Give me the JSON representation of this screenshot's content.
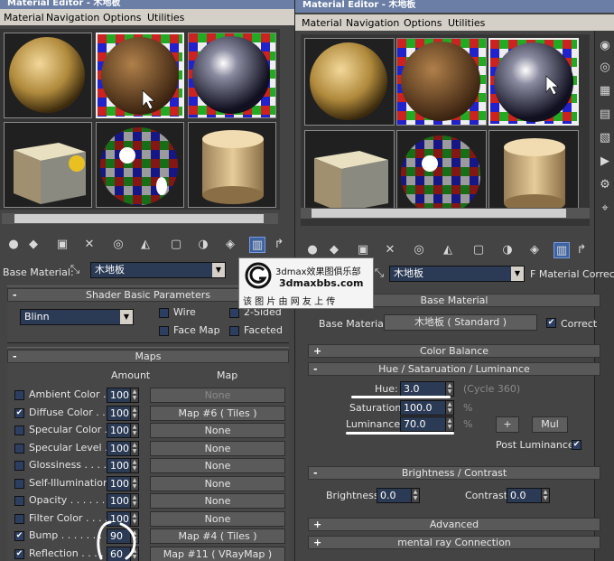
{
  "left": {
    "title": "Material Editor - 木地板",
    "menu": [
      "Material",
      "Navigation",
      "Options",
      "Utilities"
    ],
    "base_material_label": "Base Material:",
    "base_material_value": "木地板",
    "shader_header": "Shader Basic Parameters",
    "shader_value": "Blinn",
    "checks": {
      "wire": "Wire",
      "two_sided": "2-Sided",
      "face_map": "Face Map",
      "faceted": "Faceted"
    },
    "maps_header": "Maps",
    "col_amount": "Amount",
    "col_map": "Map",
    "maps": [
      {
        "label": "Ambient Color . .",
        "checked": false,
        "amount": "100",
        "map": "None",
        "disabled": true
      },
      {
        "label": "Diffuse Color . . .",
        "checked": true,
        "amount": "100",
        "map": "Map #6  ( Tiles )",
        "disabled": false
      },
      {
        "label": "Specular Color . .",
        "checked": false,
        "amount": "100",
        "map": "None",
        "disabled": false
      },
      {
        "label": "Specular Level  .",
        "checked": false,
        "amount": "100",
        "map": "None",
        "disabled": false
      },
      {
        "label": "Glossiness . . . . .",
        "checked": false,
        "amount": "100",
        "map": "None",
        "disabled": false
      },
      {
        "label": "Self-Illumination .",
        "checked": false,
        "amount": "100",
        "map": "None",
        "disabled": false
      },
      {
        "label": "Opacity . . . . . . .",
        "checked": false,
        "amount": "100",
        "map": "None",
        "disabled": false
      },
      {
        "label": "Filter Color . . . .",
        "checked": false,
        "amount": "100",
        "map": "None",
        "disabled": false
      },
      {
        "label": "Bump  . . . . . . . .",
        "checked": true,
        "amount": "90",
        "map": "Map #4  ( Tiles )",
        "disabled": false
      },
      {
        "label": "Reflection . . . .",
        "checked": true,
        "amount": "60",
        "map": "Map #11  ( VRayMap )",
        "disabled": false
      }
    ]
  },
  "right": {
    "title": "Material Editor - 木地板",
    "menu": [
      "Material",
      "Navigation",
      "Options",
      "Utilities"
    ],
    "base_material_value": "木地板",
    "combo_suffix": "F Material Correct",
    "base_header": "Base Material",
    "base_material_label": "Base Material:",
    "base_material_button": "木地板  ( Standard )",
    "correct_label": "Correct",
    "rollouts": {
      "color_balance": "Color Balance",
      "hsl": "Hue / Sataruation / Luminance",
      "brightness_contrast": "Brightness / Contrast",
      "advanced": "Advanced",
      "mental_ray": "mental ray Connection"
    },
    "hue_label": "Hue:",
    "hue_value": "3.0",
    "hue_hint": "(Cycle 360)",
    "saturation_label": "Saturation:",
    "saturation_value": "100.0",
    "luminance_label": "Luminance:",
    "luminance_value": "70.0",
    "percent": "%",
    "plus_button": "+",
    "mul_button": "Mul",
    "post_luminance_label": "Post Luminance:",
    "brightness_label": "Brightness:",
    "brightness_value": "0.0",
    "contrast_label": "Contrast:",
    "contrast_value": "0.0"
  },
  "watermark": {
    "line1": "3dmax效果图俱乐部",
    "line2": "3dmaxbbs.com",
    "line3": "该 图 片 由 网 友 上 传"
  }
}
